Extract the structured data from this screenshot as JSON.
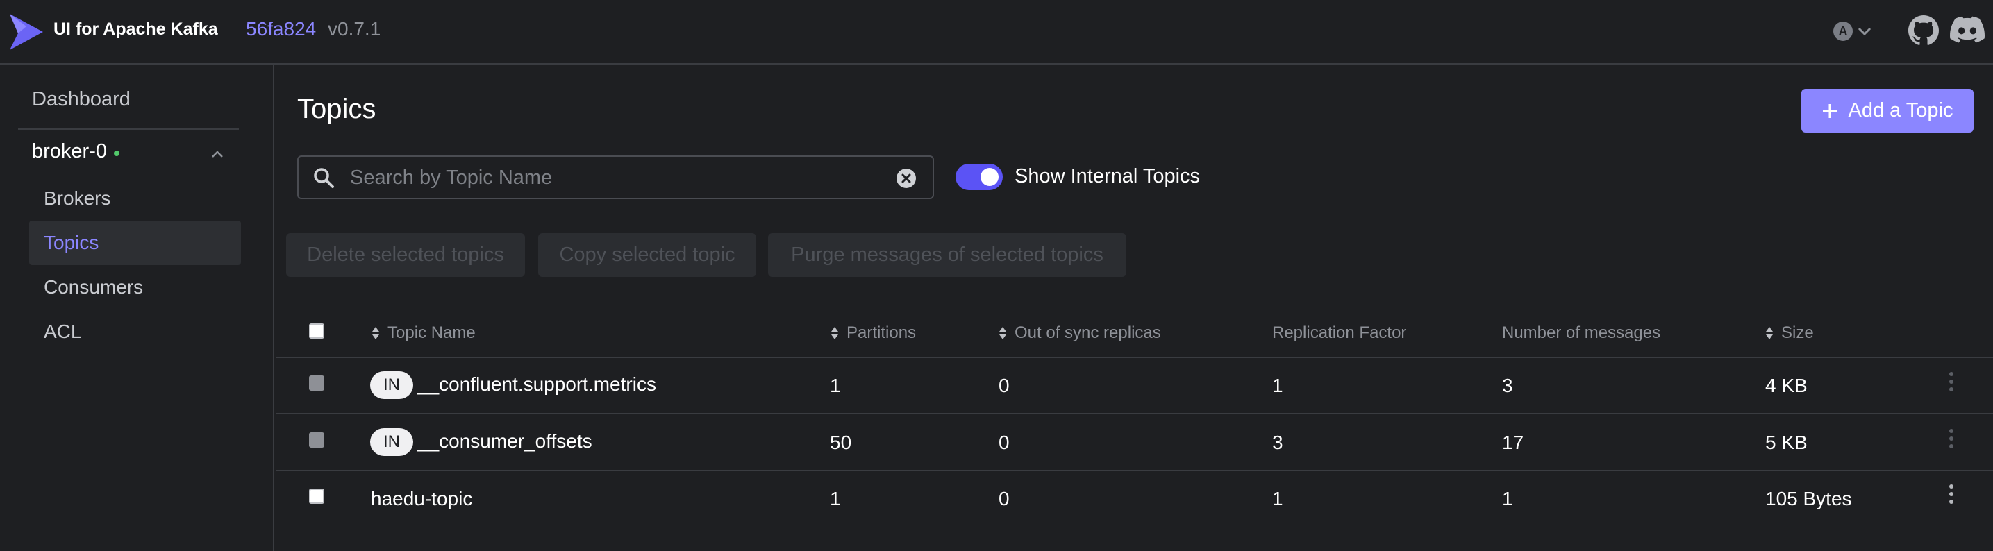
{
  "header": {
    "app_title": "UI for Apache Kafka",
    "commit": "56fa824",
    "version": "v0.7.1",
    "user_initial": "A"
  },
  "sidebar": {
    "dashboard": "Dashboard",
    "cluster_name": "broker-0",
    "items": [
      {
        "label": "Brokers",
        "active": false
      },
      {
        "label": "Topics",
        "active": true
      },
      {
        "label": "Consumers",
        "active": false
      },
      {
        "label": "ACL",
        "active": false
      }
    ]
  },
  "main": {
    "title": "Topics",
    "add_button": "Add a Topic",
    "search_placeholder": "Search by Topic Name",
    "show_internal_label": "Show Internal Topics",
    "show_internal_enabled": true,
    "actions": {
      "delete": "Delete selected topics",
      "copy": "Copy selected topic",
      "purge": "Purge messages of selected topics"
    }
  },
  "table": {
    "headers": {
      "name": "Topic Name",
      "partitions": "Partitions",
      "out_of_sync": "Out of sync replicas",
      "replication": "Replication Factor",
      "messages": "Number of messages",
      "size": "Size"
    },
    "rows": [
      {
        "internal": true,
        "badge": "IN",
        "name": "__confluent.support.metrics",
        "partitions": "1",
        "out_of_sync": "0",
        "replication": "1",
        "messages": "3",
        "size": "4 KB"
      },
      {
        "internal": true,
        "badge": "IN",
        "name": "__consumer_offsets",
        "partitions": "50",
        "out_of_sync": "0",
        "replication": "3",
        "messages": "17",
        "size": "5 KB"
      },
      {
        "internal": false,
        "badge": "",
        "name": "haedu-topic",
        "partitions": "1",
        "out_of_sync": "0",
        "replication": "1",
        "messages": "1",
        "size": "105 Bytes"
      }
    ]
  },
  "colors": {
    "accent": "#8b86ff",
    "toggle_on": "#5b53f5",
    "background": "#1e1f22",
    "online_dot": "#52c96b"
  }
}
